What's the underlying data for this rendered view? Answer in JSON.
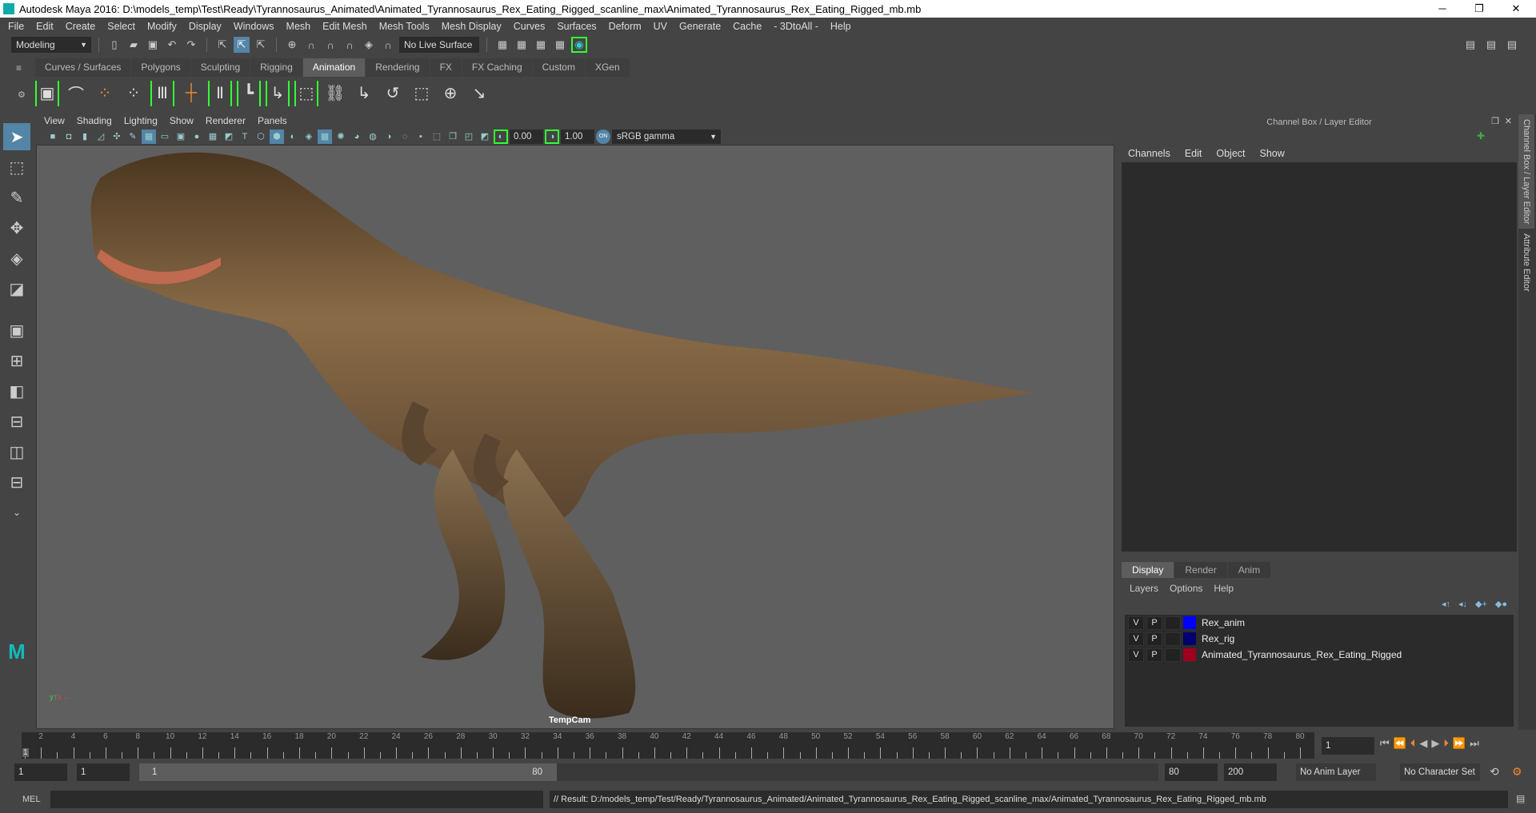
{
  "window": {
    "title": "Autodesk Maya 2016: D:\\models_temp\\Test\\Ready\\Tyrannosaurus_Animated\\Animated_Tyrannosaurus_Rex_Eating_Rigged_scanline_max\\Animated_Tyrannosaurus_Rex_Eating_Rigged_mb.mb",
    "minimize": "─",
    "restore": "❐",
    "close": "✕"
  },
  "menu": [
    "File",
    "Edit",
    "Create",
    "Select",
    "Modify",
    "Display",
    "Windows",
    "Mesh",
    "Edit Mesh",
    "Mesh Tools",
    "Mesh Display",
    "Curves",
    "Surfaces",
    "Deform",
    "UV",
    "Generate",
    "Cache",
    "- 3DtoAll -",
    "Help"
  ],
  "status": {
    "mode": "Modeling",
    "live_surface": "No Live Surface"
  },
  "shelf_tabs": [
    "Curves / Surfaces",
    "Polygons",
    "Sculpting",
    "Rigging",
    "Animation",
    "Rendering",
    "FX",
    "FX Caching",
    "Custom",
    "XGen"
  ],
  "shelf_active": "Animation",
  "viewport": {
    "menu": [
      "View",
      "Shading",
      "Lighting",
      "Show",
      "Renderer",
      "Panels"
    ],
    "exposure": "0.00",
    "gamma": "1.00",
    "color_space": "sRGB gamma",
    "camera": "TempCam"
  },
  "channel_box": {
    "title": "Channel Box / Layer Editor",
    "menu": [
      "Channels",
      "Edit",
      "Object",
      "Show"
    ]
  },
  "layer_editor": {
    "tabs": [
      "Display",
      "Render",
      "Anim"
    ],
    "menu": [
      "Layers",
      "Options",
      "Help"
    ],
    "layers": [
      {
        "v": "V",
        "p": "P",
        "name": "Rex_anim",
        "color": "#0000ff"
      },
      {
        "v": "V",
        "p": "P",
        "name": "Rex_rig",
        "color": "#000070"
      },
      {
        "v": "V",
        "p": "P",
        "name": "Animated_Tyrannosaurus_Rex_Eating_Rigged",
        "color": "#a00020"
      }
    ]
  },
  "side_tabs": [
    "Channel Box / Layer Editor",
    "Attribute Editor"
  ],
  "timeline": {
    "start": 1,
    "end": 80,
    "labels": [
      2,
      4,
      6,
      8,
      10,
      12,
      14,
      16,
      18,
      20,
      22,
      24,
      26,
      28,
      30,
      32,
      34,
      36,
      38,
      40,
      42,
      44,
      46,
      48,
      50,
      52,
      54,
      56,
      58,
      60,
      62,
      64,
      66,
      68,
      70,
      72,
      74,
      76,
      78,
      80
    ],
    "current_frame_label": "1",
    "current_frame_field": "1"
  },
  "range": {
    "anim_start": "1",
    "play_start": "1",
    "slider_start": "1",
    "slider_end": "80",
    "play_end": "80",
    "anim_end": "200",
    "anim_layer": "No Anim Layer",
    "char_set": "No Character Set"
  },
  "command": {
    "lang": "MEL",
    "result": "// Result: D:/models_temp/Test/Ready/Tyrannosaurus_Animated/Animated_Tyrannosaurus_Rex_Eating_Rigged_scanline_max/Animated_Tyrannosaurus_Rex_Eating_Rigged_mb.mb"
  }
}
